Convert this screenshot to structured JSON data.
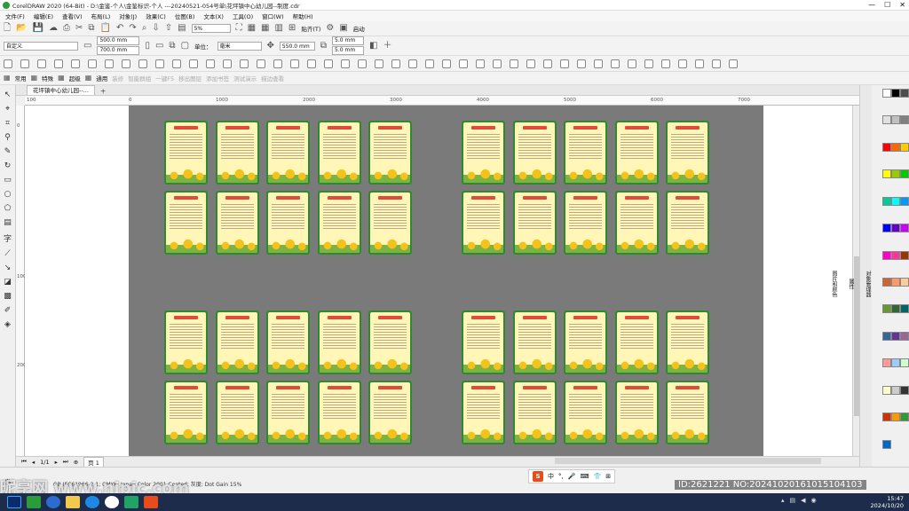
{
  "window": {
    "title": "CorelDRAW 2020 (64-Bit) - D:\\金鉴-个人\\金鉴标识-个人 ---20240521-054号单\\花坪镇中心幼儿园--制度.cdr",
    "controls": [
      "—",
      "☐",
      "✕"
    ]
  },
  "menu": [
    "文件(F)",
    "编辑(E)",
    "查看(V)",
    "布局(L)",
    "对象(J)",
    "效果(C)",
    "位图(B)",
    "文本(X)",
    "工具(O)",
    "窗口(W)",
    "帮助(H)"
  ],
  "toolbar1": {
    "zoom": "5%",
    "snap": "贴齐(T)",
    "launch": "启动"
  },
  "property_bar": {
    "page_preset": "自定义",
    "width": "500.0 mm",
    "height": "700.0 mm",
    "units_label": "单位：",
    "units": "毫米",
    "nudge": "550.0 mm",
    "dup_x": "5.0 mm",
    "dup_y": "5.0 mm"
  },
  "toolbar4": [
    "常用",
    "特殊",
    "超级",
    "通用",
    "装修",
    "智能群组",
    "一键F5",
    "移出图层",
    "添加书签",
    "测试演示",
    "描边查看"
  ],
  "document_tab": "花坪镇中心幼儿园--...",
  "ruler": {
    "h_ticks": [
      "100",
      "0",
      "1000",
      "2000",
      "3000",
      "4000",
      "5000",
      "6000",
      "7000"
    ],
    "v_ticks": [
      "0",
      "1000",
      "2000"
    ]
  },
  "canvas": {
    "boards_per_row": 5,
    "rows": 4,
    "columns_groups": 2
  },
  "page_nav": {
    "page_label": "页 1",
    "counter": "1/1"
  },
  "status": {
    "color_profile": "GB IEC61966-2.1; CMYK: Japan Color 2001 Coated; 灰度: Dot Gain 15%"
  },
  "ime": [
    "中",
    "°,",
    "🎤",
    "⌨",
    "👕",
    "⊞"
  ],
  "watermark": {
    "left": "昵享网 www.nipic.com",
    "right": "ID:2621221 NO:20241020161015104103"
  },
  "taskbar": {
    "clock_time": "15:47",
    "clock_date": "2024/10/20"
  },
  "dockers": [
    "对象管理器",
    "属性",
    "图片和颜色"
  ],
  "palette": [
    "#ffffff",
    "#000000",
    "#4d4d4d",
    "#e0e0e0",
    "#c0c0c0",
    "#808080",
    "#ff0000",
    "#ff6600",
    "#ffcc00",
    "#ffff00",
    "#99cc00",
    "#00cc00",
    "#00cc99",
    "#00ffff",
    "#0099ff",
    "#0000ff",
    "#6600cc",
    "#cc00ff",
    "#ff00cc",
    "#ff3399",
    "#993300",
    "#cc6633",
    "#ff9966",
    "#ffcc99",
    "#669933",
    "#336633",
    "#006666",
    "#336699",
    "#663399",
    "#996699",
    "#ff9999",
    "#99ccff",
    "#ccffcc",
    "#ffffcc",
    "#cccccc",
    "#333333",
    "#cc3300",
    "#ff9900",
    "#339933",
    "#0066cc"
  ]
}
